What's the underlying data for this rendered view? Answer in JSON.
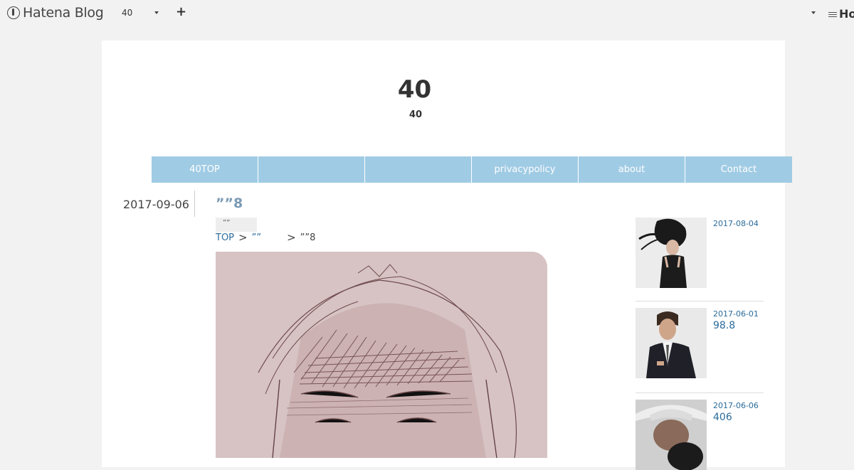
{
  "topbar": {
    "brand": "Hatena Blog",
    "blog_selector": "40",
    "add_label": "+",
    "right_brand": "Ho"
  },
  "header": {
    "title": "40",
    "description": "40"
  },
  "nav": {
    "items": [
      "40TOP",
      "",
      "",
      "privacypolicy",
      "about",
      "Contact"
    ]
  },
  "entry": {
    "date": "2017-09-06",
    "title": "””8",
    "category": "””",
    "breadcrumb": {
      "top": "TOP",
      "sep1": ">",
      "category": "””",
      "sep2": ">",
      "current": "””8"
    }
  },
  "sidebar": {
    "items": [
      {
        "date": "2017-08-04",
        "title": ""
      },
      {
        "date": "2017-06-01",
        "title": "98.8"
      },
      {
        "date": "2017-06-06",
        "title": "406"
      }
    ]
  },
  "colors": {
    "nav_bg": "#a0cbe4",
    "link": "#2b6b9a",
    "entry_title": "#7a9ab5",
    "page_bg": "#f2f2f2"
  }
}
